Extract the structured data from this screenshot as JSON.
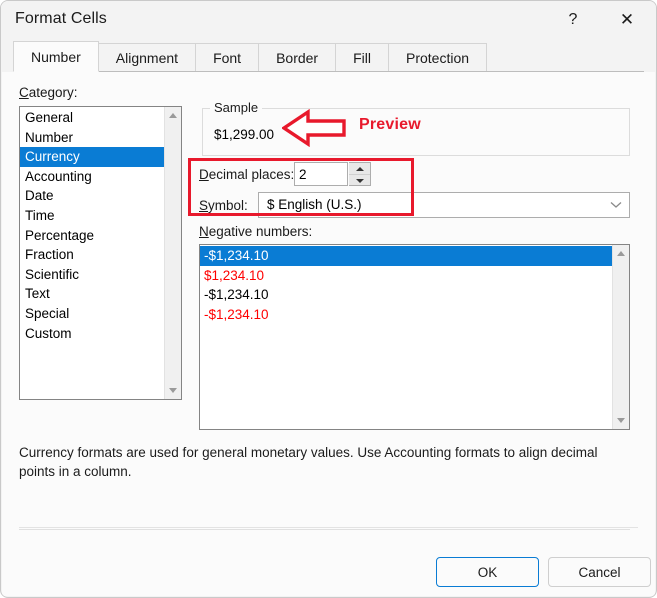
{
  "window": {
    "title": "Format Cells",
    "help_icon": "question-mark-icon",
    "close_icon": "close-x-icon"
  },
  "tabs": [
    {
      "label": "Number",
      "active": true
    },
    {
      "label": "Alignment",
      "active": false
    },
    {
      "label": "Font",
      "active": false
    },
    {
      "label": "Border",
      "active": false
    },
    {
      "label": "Fill",
      "active": false
    },
    {
      "label": "Protection",
      "active": false
    }
  ],
  "category": {
    "label": "Category:",
    "items": [
      {
        "label": "General",
        "selected": false
      },
      {
        "label": "Number",
        "selected": false
      },
      {
        "label": "Currency",
        "selected": true
      },
      {
        "label": "Accounting",
        "selected": false
      },
      {
        "label": "Date",
        "selected": false
      },
      {
        "label": "Time",
        "selected": false
      },
      {
        "label": "Percentage",
        "selected": false
      },
      {
        "label": "Fraction",
        "selected": false
      },
      {
        "label": "Scientific",
        "selected": false
      },
      {
        "label": "Text",
        "selected": false
      },
      {
        "label": "Special",
        "selected": false
      },
      {
        "label": "Custom",
        "selected": false
      }
    ]
  },
  "sample": {
    "legend": "Sample",
    "value": "$1,299.00"
  },
  "annotation": {
    "preview_label": "Preview",
    "arrow_color": "#e8192c",
    "rect_color": "#e8192c"
  },
  "decimal_places": {
    "label": "Decimal places:",
    "value": "2"
  },
  "symbol": {
    "label": "Symbol:",
    "value": "$ English (U.S.)"
  },
  "negative_numbers": {
    "label": "Negative numbers:",
    "items": [
      {
        "label": "-$1,234.10",
        "color": "#000000",
        "selected": true
      },
      {
        "label": "$1,234.10",
        "color": "#ff0000",
        "selected": false
      },
      {
        "label": "-$1,234.10",
        "color": "#000000",
        "selected": false
      },
      {
        "label": "-$1,234.10",
        "color": "#ff0000",
        "selected": false
      }
    ]
  },
  "description": "Currency formats are used for general monetary values.  Use Accounting formats to align decimal points in a column.",
  "footer": {
    "ok_label": "OK",
    "cancel_label": "Cancel"
  },
  "colors": {
    "selection_blue": "#0a7cd4",
    "accent_red": "#e8192c",
    "negative_red": "#ff0000"
  }
}
